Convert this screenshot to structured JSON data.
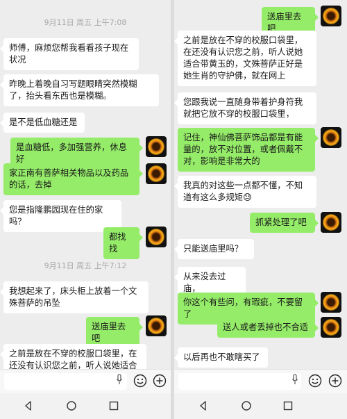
{
  "left": {
    "messages": [
      {
        "type": "time",
        "text": "9月11日 周五 上午7:08"
      },
      {
        "type": "recv",
        "text": "师傅，麻烦您帮我看看孩子现在状况"
      },
      {
        "type": "recv",
        "text": "昨晚上着晚自习写题眼睛突然模糊了，抬头看东西也是模糊。"
      },
      {
        "type": "recv",
        "text": "是不是低血糖还是"
      },
      {
        "type": "sent",
        "text": "是血糖低，多加强营养，休息好"
      },
      {
        "type": "sent",
        "text": "家正南有菩萨相关物品以及药品的话，去掉"
      },
      {
        "type": "recv",
        "text": "您是指隆鹏园现在住的家吗？"
      },
      {
        "type": "sent",
        "text": "都找找"
      },
      {
        "type": "time",
        "text": "9月11日 周五 上午7:12"
      },
      {
        "type": "recv",
        "text": "我想起来了，床头柜上放着一个文殊菩萨的吊坠"
      },
      {
        "type": "sent",
        "text": "送庙里去吧"
      },
      {
        "type": "recv",
        "text": "之前是放在不穿的校服口袋里，在还没有认识您之前，听人说她适合"
      }
    ]
  },
  "right": {
    "messages": [
      {
        "type": "sent",
        "text": "送庙里去吧"
      },
      {
        "type": "recv",
        "text": "之前是放在不穿的校服口袋里，在还没有认识您之前，听人说她适合带黄玉的，文殊菩萨正好是她生肖的守护佛，就在网上"
      },
      {
        "type": "recv",
        "text": "您跟我说一直随身带着护身符我就把它放不穿的校服口袋里，"
      },
      {
        "type": "sent",
        "text": "记住，神仙佛菩萨饰品都是有能量的，放不对位置，或者佩戴不对，影响是非常大的"
      },
      {
        "type": "recv",
        "text": "我真的对这些一点都不懂，不知道有这么多规矩😓"
      },
      {
        "type": "sent",
        "text": "抓紧处理了吧"
      },
      {
        "type": "recv",
        "text": "只能送庙里吗？"
      },
      {
        "type": "recv",
        "text": "从来没去过庙，"
      },
      {
        "type": "sent",
        "text": "你这个有些问，有瑕疵，不要留了"
      },
      {
        "type": "sent",
        "text": "送人或者丢掉也不合适"
      },
      {
        "type": "recv",
        "text": "以后再也不敢瞎买了"
      }
    ]
  },
  "icons": {
    "mic": "microphone-icon",
    "emoji": "emoji-icon",
    "plus": "plus-icon",
    "back": "nav-back-icon",
    "home": "nav-home-icon",
    "recents": "nav-recents-icon"
  },
  "colors": {
    "sent_bubble": "#95ec69",
    "recv_bubble": "#ffffff",
    "chat_bg": "#ededed"
  }
}
